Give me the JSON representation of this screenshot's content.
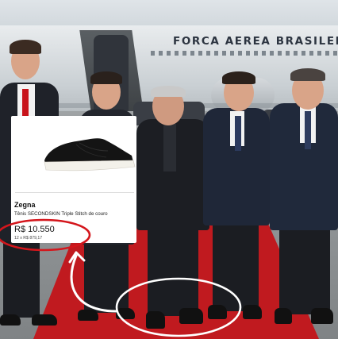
{
  "background": {
    "aircraft_livery": "FORCA AEREA BRASILEIRA",
    "carpet_color": "#c01a1f"
  },
  "product_card": {
    "brand": "Zegna",
    "product_name": "Tênis SECONDSKIN Triple Stitch de couro",
    "price": "R$ 10.550",
    "installments": "12 x R$ 879,17"
  },
  "annotations": {
    "circle_color": "#d4161c",
    "arrow_color": "#ffffff",
    "shoe_circle_color": "#ffffff"
  }
}
